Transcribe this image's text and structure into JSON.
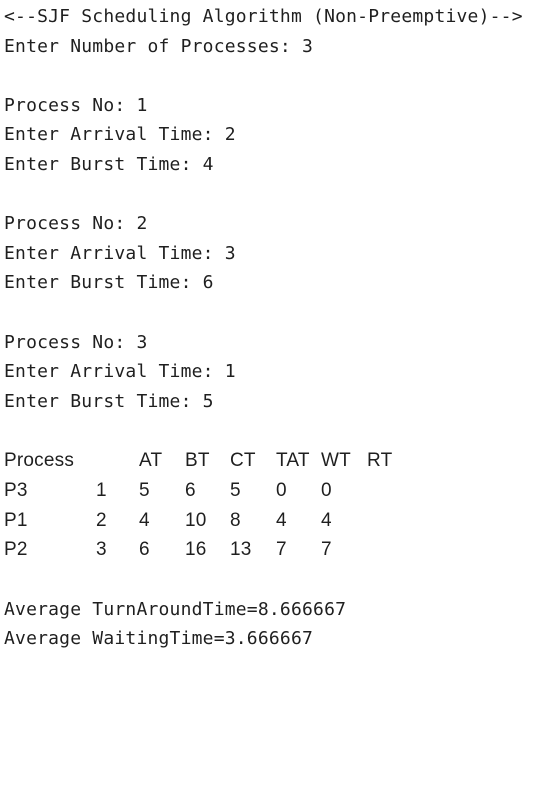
{
  "header": "<--SJF Scheduling Algorithm (Non-Preemptive)-->",
  "num_prompt": "Enter Number of Processes: 3",
  "processes": [
    {
      "no": "Process No: 1",
      "arrival": "Enter Arrival Time: 2",
      "burst": "Enter Burst Time: 4"
    },
    {
      "no": "Process No: 2",
      "arrival": "Enter Arrival Time: 3",
      "burst": "Enter Burst Time: 6"
    },
    {
      "no": "Process No: 3",
      "arrival": "Enter Arrival Time: 1",
      "burst": "Enter Burst Time: 5"
    }
  ],
  "table": {
    "headers": [
      "Process",
      "AT",
      "BT",
      "CT",
      "TAT",
      "WT",
      "RT"
    ],
    "rows": [
      [
        "P3",
        "1",
        "5",
        "6",
        "5",
        "0",
        "0"
      ],
      [
        "P1",
        "2",
        "4",
        "10",
        "8",
        "4",
        "4"
      ],
      [
        "P2",
        "3",
        "6",
        "16",
        "13",
        "7",
        "7"
      ]
    ]
  },
  "avg_tat": "Average TurnAroundTime=8.666667",
  "avg_wt": "Average WaitingTime=3.666667"
}
